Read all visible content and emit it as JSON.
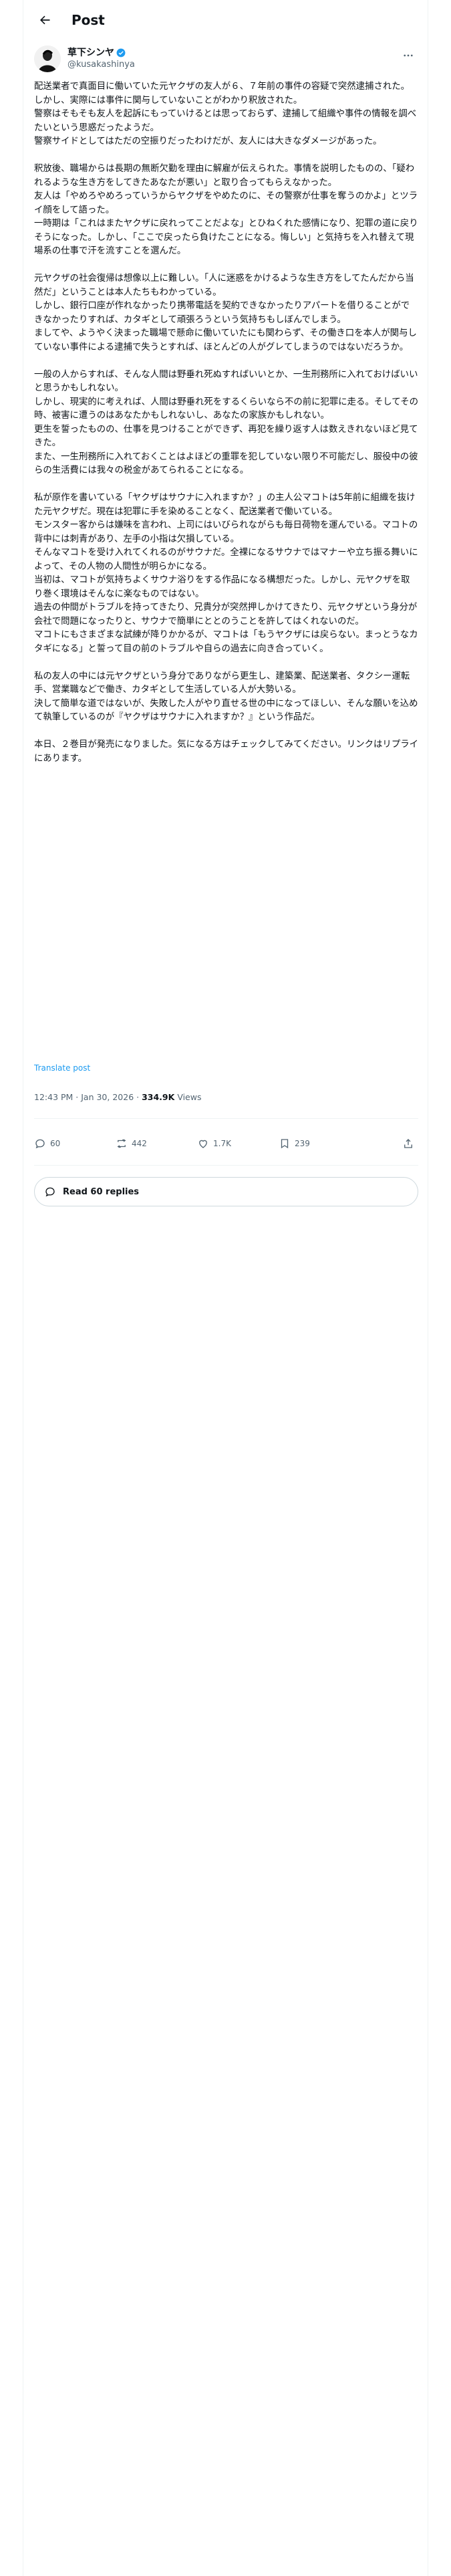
{
  "header": {
    "title": "Post"
  },
  "author": {
    "name": "草下シンヤ",
    "handle": "@kusakashinya"
  },
  "tweet": {
    "text": "配送業者で真面目に働いていた元ヤクザの友人が６、７年前の事件の容疑で突然逮捕された。しかし、実際には事件に関与していないことがわかり釈放された。\n警察はそもそも友人を起訴にもっていけるとは思っておらず、逮捕して組織や事件の情報を調べたいという思惑だったようだ。\n警察サイドとしてはただの空振りだったわけだが、友人には大きなダメージがあった。\n\n釈放後、職場からは長期の無断欠勤を理由に解雇が伝えられた。事情を説明したものの、「疑われるような生き方をしてきたあなたが悪い」と取り合ってもらえなかった。\n友人は「やめろやめろっていうからヤクザをやめたのに、その警察が仕事を奪うのかよ」とツライ顔をして語った。\n一時期は「これはまたヤクザに戻れってことだよな」とひねくれた感情になり、犯罪の道に戻りそうになった。しかし、「ここで戻ったら負けたことになる。悔しい」と気持ちを入れ替えて現場系の仕事で汗を流すことを選んだ。\n\n元ヤクザの社会復帰は想像以上に難しい。「人に迷惑をかけるような生き方をしてたんだから当然だ」ということは本人たちもわかっている。\nしかし、銀行口座が作れなかったり携帯電話を契約できなかったりアパートを借りることができなかったりすれば、カタギとして頑張ろうという気持ちもしぼんでしまう。\nましてや、ようやく決まった職場で懸命に働いていたにも関わらず、その働き口を本人が関与していない事件による逮捕で失うとすれば、ほとんどの人がグレてしまうのではないだろうか。\n\n一般の人からすれば、そんな人間は野垂れ死ぬすればいいとか、一生刑務所に入れておけばいいと思うかもしれない。\nしかし、現実的に考えれば、人間は野垂れ死をするくらいなら不の前に犯罪に走る。そしてその時、被害に遭うのはあなたかもしれないし、あなたの家族かもしれない。\n更生を誓ったものの、仕事を見つけることができず、再犯を繰り返す人は数えきれないほど見てきた。\nまた、一生刑務所に入れておくことはよほどの重罪を犯していない限り不可能だし、服役中の彼らの生活費には我々の税金があてられることになる。\n\n私が原作を書いている「ヤクザはサウナに入れますか？」の主人公マコトは5年前に組織を抜けた元ヤクザだ。現在は犯罪に手を染めることなく、配送業者で働いている。\nモンスター客からは嫌味を言われ、上司にはいびられながらも毎日荷物を運んでいる。マコトの背中には刺青があり、左手の小指は欠損している。\nそんなマコトを受け入れてくれるのがサウナだ。全裸になるサウナではマナーや立ち振る舞いによって、その人物の人間性が明らかになる。\n当初は、マコトが気持ちよくサウナ浴りをする作品になる構想だった。しかし、元ヤクザを取り巻く環境はそんなに楽なものではない。\n過去の仲間がトラブルを持ってきたり、兄貴分が突然押しかけてきたり、元ヤクザという身分が会社で問題になったりと、サウナで簡単にととのうことを許してはくれないのだ。\nマコトにもさまざまな試練が降りかかるが、マコトは「もうヤクザには戻らない。まっとうなカタギになる」と誓って目の前のトラブルや自らの過去に向き合っていく。\n\n私の友人の中には元ヤクザという身分でありながら更生し、建築業、配送業者、タクシー運転手、営業職などで働き、カタギとして生活している人が大勢いる。\n決して簡単な道ではないが、失敗した人がやり直せる世の中になってほしい、そんな願いを込めて執筆しているのが『ヤクザはサウナに入れますか？』という作品だ。\n\n本日、２巻目が発売になりました。気になる方はチェックしてみてください。リンクはリプライにあります。",
    "translate_label": "Translate post",
    "time": "12:43 PM · Jan 30, 2026",
    "views_count": "334.9K",
    "views_label": "Views"
  },
  "actions": {
    "replies": "60",
    "reposts": "442",
    "likes": "1.7K",
    "bookmarks": "239"
  },
  "read_replies_label": "Read 60 replies",
  "colors": {
    "accent": "#1d9bf0",
    "muted": "#536471",
    "text": "#0f1419",
    "border": "#eff3f4"
  }
}
